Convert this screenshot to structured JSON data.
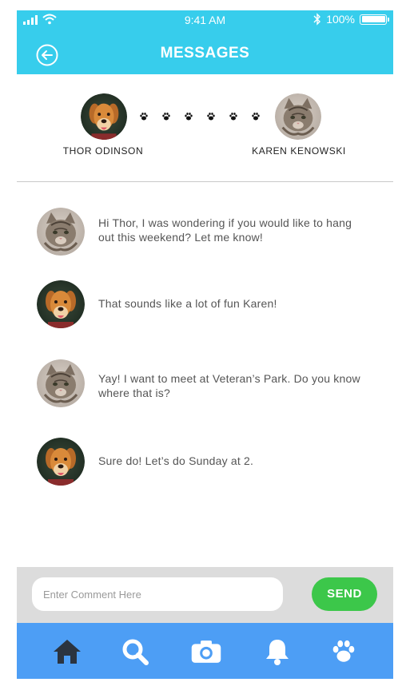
{
  "status_bar": {
    "time": "9:41 AM",
    "battery_text": "100%",
    "battery_level": 1.0
  },
  "header": {
    "title": "MESSAGES",
    "back_icon": "back-arrow-icon",
    "background_color": "#37cdec"
  },
  "participants": [
    {
      "name": "THOR ODINSON",
      "avatar": "dog-avatar"
    },
    {
      "name": "KAREN KENOWSKI",
      "avatar": "cat-avatar"
    }
  ],
  "connector_icon": "paw-icon",
  "messages": [
    {
      "sender": "cat",
      "text": "Hi Thor, I was wondering if you would like to hang out this weekend? Let me know!"
    },
    {
      "sender": "dog",
      "text": "That sounds like a lot of fun Karen!"
    },
    {
      "sender": "cat",
      "text": "Yay! I want to meet at Veteran’s Park. Do you know where that is?"
    },
    {
      "sender": "dog",
      "text": "Sure do! Let’s do Sunday at 2."
    }
  ],
  "comment": {
    "placeholder": "Enter Comment Here",
    "value": "",
    "send_label": "SEND",
    "send_color": "#3cc74a"
  },
  "bottom_nav": {
    "background_color": "#4d9ef5",
    "items": [
      "home-icon",
      "search-icon",
      "camera-icon",
      "bell-icon",
      "paw-icon"
    ]
  }
}
